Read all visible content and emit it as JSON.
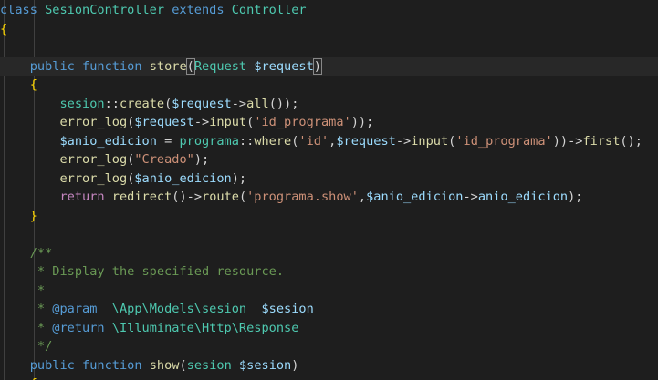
{
  "editor": {
    "language": "php",
    "theme_colors": {
      "background": "#1e1e1e",
      "keyword": "#569cd6",
      "class": "#4ec9b0",
      "function": "#dcdcaa",
      "variable": "#9cdcfe",
      "string": "#ce9178",
      "comment": "#6a9955"
    },
    "lines": [
      {
        "current": false,
        "tokens": [
          {
            "t": "kw",
            "v": "class"
          },
          {
            "t": "pun",
            "v": " "
          },
          {
            "t": "cls",
            "v": "SesionController"
          },
          {
            "t": "pun",
            "v": " "
          },
          {
            "t": "kw",
            "v": "extends"
          },
          {
            "t": "pun",
            "v": " "
          },
          {
            "t": "cls",
            "v": "Controller"
          }
        ]
      },
      {
        "current": false,
        "tokens": [
          {
            "t": "brace",
            "v": "{"
          }
        ]
      },
      {
        "current": false,
        "tokens": []
      },
      {
        "current": true,
        "tokens": [
          {
            "t": "pun",
            "v": "    "
          },
          {
            "t": "kw",
            "v": "public"
          },
          {
            "t": "pun",
            "v": " "
          },
          {
            "t": "kw",
            "v": "function"
          },
          {
            "t": "pun",
            "v": " "
          },
          {
            "t": "fn",
            "v": "store"
          },
          {
            "t": "pun",
            "v": "(",
            "match": true
          },
          {
            "t": "cls",
            "v": "Request"
          },
          {
            "t": "pun",
            "v": " "
          },
          {
            "t": "var",
            "v": "$request"
          },
          {
            "t": "pun",
            "v": ")",
            "match": true
          }
        ]
      },
      {
        "current": false,
        "tokens": [
          {
            "t": "pun",
            "v": "    "
          },
          {
            "t": "brace",
            "v": "{"
          }
        ]
      },
      {
        "current": false,
        "tokens": [
          {
            "t": "pun",
            "v": "        "
          },
          {
            "t": "cls",
            "v": "sesion"
          },
          {
            "t": "pun",
            "v": "::"
          },
          {
            "t": "fn",
            "v": "create"
          },
          {
            "t": "pun",
            "v": "("
          },
          {
            "t": "var",
            "v": "$request"
          },
          {
            "t": "pun",
            "v": "->"
          },
          {
            "t": "fn",
            "v": "all"
          },
          {
            "t": "pun",
            "v": "());"
          }
        ]
      },
      {
        "current": false,
        "tokens": [
          {
            "t": "pun",
            "v": "        "
          },
          {
            "t": "fn",
            "v": "error_log"
          },
          {
            "t": "pun",
            "v": "("
          },
          {
            "t": "var",
            "v": "$request"
          },
          {
            "t": "pun",
            "v": "->"
          },
          {
            "t": "fn",
            "v": "input"
          },
          {
            "t": "pun",
            "v": "("
          },
          {
            "t": "str",
            "v": "'id_programa'"
          },
          {
            "t": "pun",
            "v": "));"
          }
        ]
      },
      {
        "current": false,
        "tokens": [
          {
            "t": "pun",
            "v": "        "
          },
          {
            "t": "var",
            "v": "$anio_edicion"
          },
          {
            "t": "pun",
            "v": " = "
          },
          {
            "t": "cls",
            "v": "programa"
          },
          {
            "t": "pun",
            "v": "::"
          },
          {
            "t": "fn",
            "v": "where"
          },
          {
            "t": "pun",
            "v": "("
          },
          {
            "t": "str",
            "v": "'id'"
          },
          {
            "t": "pun",
            "v": ","
          },
          {
            "t": "var",
            "v": "$request"
          },
          {
            "t": "pun",
            "v": "->"
          },
          {
            "t": "fn",
            "v": "input"
          },
          {
            "t": "pun",
            "v": "("
          },
          {
            "t": "str",
            "v": "'id_programa'"
          },
          {
            "t": "pun",
            "v": "))->"
          },
          {
            "t": "fn",
            "v": "first"
          },
          {
            "t": "pun",
            "v": "();"
          }
        ]
      },
      {
        "current": false,
        "tokens": [
          {
            "t": "pun",
            "v": "        "
          },
          {
            "t": "fn",
            "v": "error_log"
          },
          {
            "t": "pun",
            "v": "("
          },
          {
            "t": "str",
            "v": "\"Creado\""
          },
          {
            "t": "pun",
            "v": ");"
          }
        ]
      },
      {
        "current": false,
        "tokens": [
          {
            "t": "pun",
            "v": "        "
          },
          {
            "t": "fn",
            "v": "error_log"
          },
          {
            "t": "pun",
            "v": "("
          },
          {
            "t": "var",
            "v": "$anio_edicion"
          },
          {
            "t": "pun",
            "v": ");"
          }
        ]
      },
      {
        "current": false,
        "tokens": [
          {
            "t": "pun",
            "v": "        "
          },
          {
            "t": "ctl",
            "v": "return"
          },
          {
            "t": "pun",
            "v": " "
          },
          {
            "t": "fn",
            "v": "redirect"
          },
          {
            "t": "pun",
            "v": "()->"
          },
          {
            "t": "fn",
            "v": "route"
          },
          {
            "t": "pun",
            "v": "("
          },
          {
            "t": "str",
            "v": "'programa.show'"
          },
          {
            "t": "pun",
            "v": ","
          },
          {
            "t": "var",
            "v": "$anio_edicion"
          },
          {
            "t": "pun",
            "v": "->"
          },
          {
            "t": "var",
            "v": "anio_edicion"
          },
          {
            "t": "pun",
            "v": ");"
          }
        ]
      },
      {
        "current": false,
        "tokens": [
          {
            "t": "pun",
            "v": "    "
          },
          {
            "t": "brace",
            "v": "}"
          }
        ]
      },
      {
        "current": false,
        "tokens": []
      },
      {
        "current": false,
        "tokens": [
          {
            "t": "pun",
            "v": "    "
          },
          {
            "t": "cmt",
            "v": "/**"
          }
        ]
      },
      {
        "current": false,
        "tokens": [
          {
            "t": "pun",
            "v": "     "
          },
          {
            "t": "cmt",
            "v": "* Display the specified resource."
          }
        ]
      },
      {
        "current": false,
        "tokens": [
          {
            "t": "pun",
            "v": "     "
          },
          {
            "t": "cmt",
            "v": "*"
          }
        ]
      },
      {
        "current": false,
        "tokens": [
          {
            "t": "pun",
            "v": "     "
          },
          {
            "t": "cmt",
            "v": "* "
          },
          {
            "t": "tag",
            "v": "@param"
          },
          {
            "t": "cmt",
            "v": "  "
          },
          {
            "t": "cls",
            "v": "\\App\\Models\\sesion"
          },
          {
            "t": "cmt",
            "v": "  "
          },
          {
            "t": "var",
            "v": "$sesion"
          }
        ]
      },
      {
        "current": false,
        "tokens": [
          {
            "t": "pun",
            "v": "     "
          },
          {
            "t": "cmt",
            "v": "* "
          },
          {
            "t": "tag",
            "v": "@return"
          },
          {
            "t": "cmt",
            "v": " "
          },
          {
            "t": "cls",
            "v": "\\Illuminate\\Http\\Response"
          }
        ]
      },
      {
        "current": false,
        "tokens": [
          {
            "t": "pun",
            "v": "     "
          },
          {
            "t": "cmt",
            "v": "*/"
          }
        ]
      },
      {
        "current": false,
        "tokens": [
          {
            "t": "pun",
            "v": "    "
          },
          {
            "t": "kw",
            "v": "public"
          },
          {
            "t": "pun",
            "v": " "
          },
          {
            "t": "kw",
            "v": "function"
          },
          {
            "t": "pun",
            "v": " "
          },
          {
            "t": "fn",
            "v": "show"
          },
          {
            "t": "pun",
            "v": "("
          },
          {
            "t": "cls",
            "v": "sesion"
          },
          {
            "t": "pun",
            "v": " "
          },
          {
            "t": "var",
            "v": "$sesion"
          },
          {
            "t": "pun",
            "v": ")"
          }
        ]
      },
      {
        "current": false,
        "tokens": [
          {
            "t": "pun",
            "v": "    "
          },
          {
            "t": "brace",
            "v": "{"
          }
        ]
      }
    ]
  }
}
